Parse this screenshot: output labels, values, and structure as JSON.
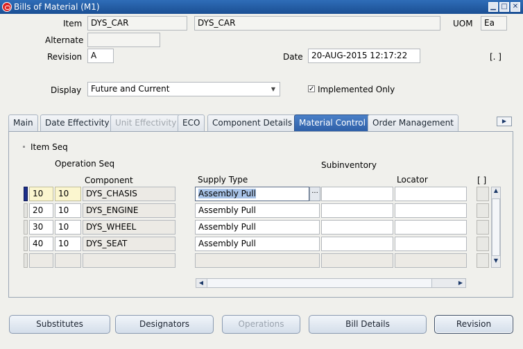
{
  "window": {
    "title": "Bills of Material (M1)",
    "minimize": "▁",
    "maximize": "□",
    "close": "✕"
  },
  "header": {
    "item_label": "Item",
    "item_value": "DYS_CAR",
    "item_description": "DYS_CAR",
    "uom_label": "UOM",
    "uom_value": "Ea",
    "alternate_label": "Alternate",
    "alternate_value": "",
    "revision_label": "Revision",
    "revision_value": "A",
    "date_label": "Date",
    "date_value": "20-AUG-2015 12:17:22",
    "descriptive_flex": "[.  ]",
    "display_label": "Display",
    "display_value": "Future and Current",
    "implemented_only_label": "Implemented Only",
    "implemented_only_checked": "✓"
  },
  "tabs": [
    {
      "label": "Main",
      "state": "normal"
    },
    {
      "label": "Date Effectivity",
      "state": "normal"
    },
    {
      "label": "Unit Effectivity",
      "state": "disabled"
    },
    {
      "label": "ECO",
      "state": "normal"
    },
    {
      "label": "Component Details",
      "state": "normal"
    },
    {
      "label": "Material Control",
      "state": "active"
    },
    {
      "label": "Order Management",
      "state": "normal"
    }
  ],
  "tab_scroll_arrow": "▶",
  "grid": {
    "item_seq_label": "Item Seq",
    "operation_seq_label": "Operation Seq",
    "component_label": "Component",
    "supply_type_label": "Supply Type",
    "subinventory_label": "Subinventory",
    "locator_label": "Locator",
    "flex_label": "[ ]",
    "lov_glyph": "···",
    "rows": [
      {
        "item_seq": "10",
        "op_seq": "10",
        "component": "DYS_CHASIS",
        "supply_type": "Assembly Pull",
        "subinventory": "",
        "locator": ""
      },
      {
        "item_seq": "20",
        "op_seq": "10",
        "component": "DYS_ENGINE",
        "supply_type": "Assembly Pull",
        "subinventory": "",
        "locator": ""
      },
      {
        "item_seq": "30",
        "op_seq": "10",
        "component": "DYS_WHEEL",
        "supply_type": "Assembly Pull",
        "subinventory": "",
        "locator": ""
      },
      {
        "item_seq": "40",
        "op_seq": "10",
        "component": "DYS_SEAT",
        "supply_type": "Assembly Pull",
        "subinventory": "",
        "locator": ""
      },
      {
        "item_seq": "",
        "op_seq": "",
        "component": "",
        "supply_type": "",
        "subinventory": "",
        "locator": ""
      }
    ]
  },
  "scrollbars": {
    "left_arrow": "◀",
    "right_arrow": "▶",
    "up_arrow": "▲",
    "down_arrow": "▼"
  },
  "buttons": {
    "substitutes": "Substitutes",
    "designators": "Designators",
    "operations": "Operations",
    "bill_details": "Bill Details",
    "revision": "Revision"
  },
  "colors": {
    "titlebar": "#1b4f93",
    "active_tab": "#2d5ea6",
    "required_field": "#fbf6cf",
    "background": "#f0f0ec"
  }
}
